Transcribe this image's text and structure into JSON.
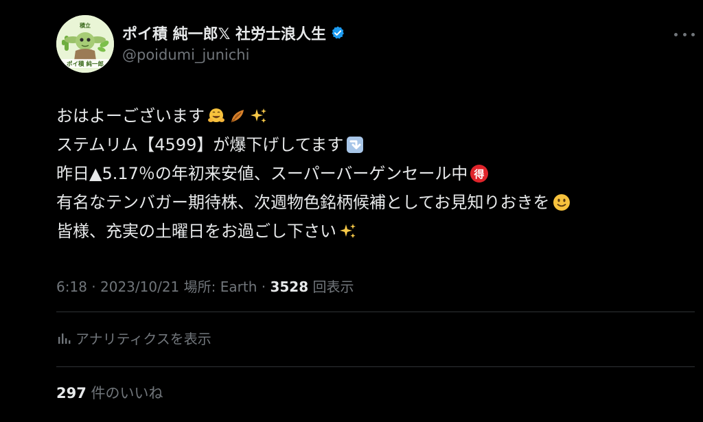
{
  "author": {
    "display_name": "ポイ積 純一郎𝕏 社労士浪人生",
    "handle": "@poidumi_junichi",
    "avatar_top_text": "積立",
    "avatar_bottom_text": "ポイ積 純一郎",
    "verified": true
  },
  "tweet": {
    "lines": [
      {
        "text": "おはよーございます",
        "emojis": [
          "hugging-face",
          "fallen-leaf",
          "sparkles"
        ]
      },
      {
        "text": "ステムリム【4599】が爆下げしてます",
        "emojis": [
          "down-arrow"
        ]
      },
      {
        "text": "昨日▲5.17％の年初来安値、スーパーバーゲンセール中",
        "emojis": [
          "bargain-mark"
        ]
      },
      {
        "text": "有名なテンバガー期待株、次週物色銘柄候補としてお見知りおきを",
        "emojis": [
          "slight-smile"
        ]
      },
      {
        "text": "皆様、充実の土曜日をお過ごし下さい",
        "emojis": [
          "sparkles"
        ]
      }
    ],
    "bargain_glyph": "得"
  },
  "meta": {
    "time": "6:18",
    "sep": " · ",
    "date": "2023/10/21",
    "location": "場所: Earth",
    "views_count": "3528",
    "views_label": "回表示"
  },
  "analytics": {
    "label": "アナリティクスを表示"
  },
  "likes": {
    "count": "297",
    "label": "件のいいね"
  },
  "colors": {
    "background": "#000000",
    "text": "#e7e9ea",
    "muted": "#71767b",
    "divider": "#2f3336",
    "verified": "#1d9bf0"
  }
}
